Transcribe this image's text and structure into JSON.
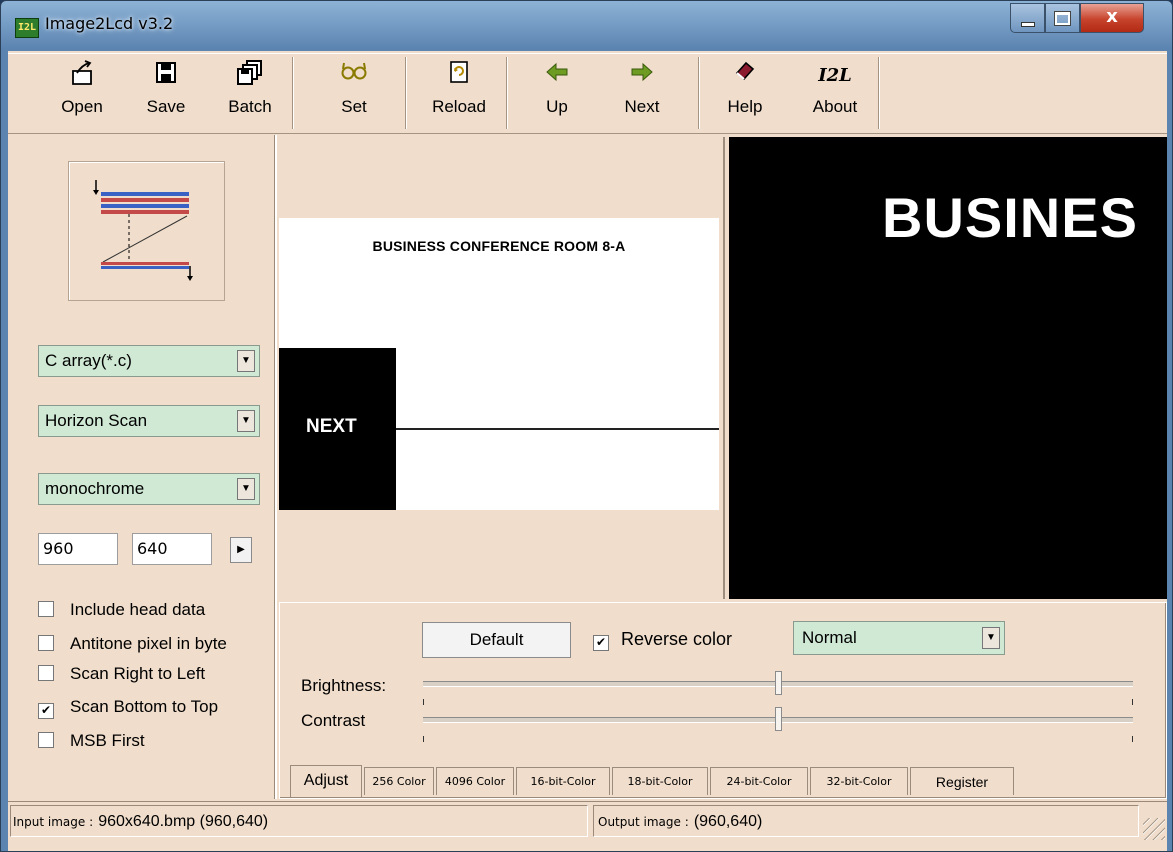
{
  "window": {
    "icon_text": "I2L",
    "title": "Image2Lcd v3.2",
    "controls": {
      "close_glyph": "x"
    }
  },
  "toolbar": {
    "items": [
      {
        "label": "Open",
        "icon": "open-icon"
      },
      {
        "label": "Save",
        "icon": "save-icon"
      },
      {
        "label": "Batch",
        "icon": "batch-icon"
      },
      {
        "label": "Set",
        "icon": "glasses-icon"
      },
      {
        "label": "Reload",
        "icon": "reload-icon"
      },
      {
        "label": "Up",
        "icon": "arrow-left-icon"
      },
      {
        "label": "Next",
        "icon": "arrow-right-icon"
      },
      {
        "label": "Help",
        "icon": "help-book-icon"
      },
      {
        "label": "About",
        "icon": "i2l-logo-icon",
        "icon_text": "I2L"
      }
    ]
  },
  "left_panel": {
    "output_type": "C array(*.c)",
    "scan_mode": "Horizon Scan",
    "color_mode": "monochrome",
    "width": "960",
    "height": "640",
    "options": [
      {
        "label": "Include head data",
        "checked": false
      },
      {
        "label": "Antitone pixel in byte",
        "checked": false
      },
      {
        "label": "Scan Right to Left",
        "checked": false
      },
      {
        "label": "Scan Bottom to Top",
        "checked": true
      },
      {
        "label": "MSB First",
        "checked": false
      }
    ]
  },
  "input_image": {
    "title": "BUSINESS CONFERENCE ROOM 8-A",
    "side_label": "NEXT"
  },
  "output_image": {
    "text": "BUSINES"
  },
  "adjust": {
    "default_label": "Default",
    "reverse_color_label": "Reverse color",
    "reverse_color_checked": true,
    "mode": "Normal",
    "brightness_label": "Brightness:",
    "contrast_label": "Contrast",
    "brightness_level": 0.5,
    "contrast_level": 0.5
  },
  "tabs": [
    "Adjust",
    "256 Color",
    "4096 Color",
    "16-bit-Color",
    "18-bit-Color",
    "24-bit-Color",
    "32-bit-Color",
    "Register"
  ],
  "status": {
    "input_key": "Input image :",
    "input_value": "960x640.bmp (960,640)",
    "output_key": "Output image :",
    "output_value": "(960,640)"
  },
  "colors": {
    "panel": "#f0ddcb",
    "combo": "#cfe9d4",
    "titlebar": "#6f96bf",
    "close": "#c7432c"
  }
}
